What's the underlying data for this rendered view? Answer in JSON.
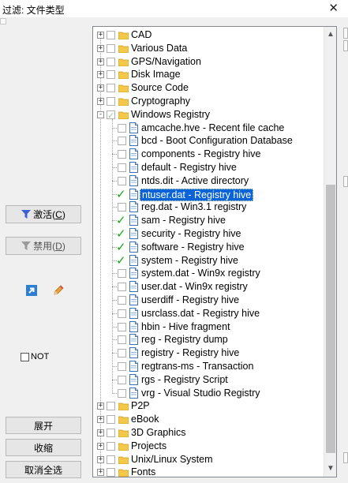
{
  "window": {
    "title": "过滤: 文件类型",
    "close": "✕"
  },
  "buttons": {
    "activate": "激活(",
    "activate_key": "C",
    "activate_end": ")",
    "disable": "禁用(",
    "disable_key": "D",
    "disable_end": ")",
    "expand": "展开",
    "collapse": "收缩",
    "deselect_all": "取消全选"
  },
  "not_label": "NOT",
  "tree": {
    "items": [
      {
        "label": "CAD",
        "level": 0,
        "expander": "+",
        "checked": false,
        "icon": "folder-icon"
      },
      {
        "label": "Various Data",
        "level": 0,
        "expander": "+",
        "checked": false,
        "icon": "folder-icon"
      },
      {
        "label": "GPS/Navigation",
        "level": 0,
        "expander": "+",
        "checked": false,
        "icon": "folder-icon"
      },
      {
        "label": "Disk Image",
        "level": 0,
        "expander": "+",
        "checked": false,
        "icon": "folder-icon"
      },
      {
        "label": "Source Code",
        "level": 0,
        "expander": "+",
        "checked": false,
        "icon": "folder-icon"
      },
      {
        "label": "Cryptography",
        "level": 0,
        "expander": "+",
        "checked": false,
        "icon": "folder-icon"
      },
      {
        "label": "Windows Registry",
        "level": 0,
        "expander": "-",
        "checked": "partial",
        "icon": "folder-icon"
      },
      {
        "label": "amcache.hve - Recent file cache",
        "level": 1,
        "checked": false,
        "icon": "document-icon"
      },
      {
        "label": "bcd - Boot Configuration Database",
        "level": 1,
        "checked": false,
        "icon": "document-icon"
      },
      {
        "label": "components - Registry hive",
        "level": 1,
        "checked": false,
        "icon": "document-icon"
      },
      {
        "label": "default - Registry hive",
        "level": 1,
        "checked": false,
        "icon": "document-icon"
      },
      {
        "label": "ntds.dit - Active directory",
        "level": 1,
        "checked": false,
        "icon": "document-icon"
      },
      {
        "label": "ntuser.dat - Registry hive",
        "level": 1,
        "checked": true,
        "selected": true,
        "icon": "document-icon"
      },
      {
        "label": "reg.dat - Win3.1 registry",
        "level": 1,
        "checked": false,
        "icon": "document-icon"
      },
      {
        "label": "sam - Registry hive",
        "level": 1,
        "checked": true,
        "icon": "document-icon"
      },
      {
        "label": "security - Registry hive",
        "level": 1,
        "checked": true,
        "icon": "document-icon"
      },
      {
        "label": "software - Registry hive",
        "level": 1,
        "checked": true,
        "icon": "document-icon"
      },
      {
        "label": "system - Registry hive",
        "level": 1,
        "checked": true,
        "icon": "document-icon"
      },
      {
        "label": "system.dat - Win9x registry",
        "level": 1,
        "checked": false,
        "icon": "document-icon"
      },
      {
        "label": "user.dat - Win9x registry",
        "level": 1,
        "checked": false,
        "icon": "document-icon"
      },
      {
        "label": "userdiff - Registry hive",
        "level": 1,
        "checked": false,
        "icon": "document-icon"
      },
      {
        "label": "usrclass.dat - Registry hive",
        "level": 1,
        "checked": false,
        "icon": "document-icon"
      },
      {
        "label": "hbin - Hive fragment",
        "level": 1,
        "checked": false,
        "icon": "document-icon"
      },
      {
        "label": "reg - Registry dump",
        "level": 1,
        "checked": false,
        "icon": "document-icon"
      },
      {
        "label": "registry - Registry hive",
        "level": 1,
        "checked": false,
        "icon": "document-icon"
      },
      {
        "label": "regtrans-ms - Transaction",
        "level": 1,
        "checked": false,
        "icon": "document-icon"
      },
      {
        "label": "rgs - Registry Script",
        "level": 1,
        "checked": false,
        "icon": "document-icon"
      },
      {
        "label": "vrg - Visual Studio Registry",
        "level": 1,
        "checked": false,
        "icon": "document-icon"
      },
      {
        "label": "P2P",
        "level": 0,
        "expander": "+",
        "checked": false,
        "icon": "folder-icon"
      },
      {
        "label": "eBook",
        "level": 0,
        "expander": "+",
        "checked": false,
        "icon": "folder-icon"
      },
      {
        "label": "3D Graphics",
        "level": 0,
        "expander": "+",
        "checked": false,
        "icon": "folder-icon"
      },
      {
        "label": "Projects",
        "level": 0,
        "expander": "+",
        "checked": false,
        "icon": "folder-icon"
      },
      {
        "label": "Unix/Linux System",
        "level": 0,
        "expander": "+",
        "checked": false,
        "icon": "folder-icon"
      },
      {
        "label": "Fonts",
        "level": 0,
        "expander": "+",
        "checked": false,
        "icon": "folder-icon"
      }
    ]
  },
  "colors": {
    "selection": "#0a64d8",
    "check": "#14a814",
    "folder": "#f4c84a",
    "filter_active": "#3c5fd8"
  }
}
